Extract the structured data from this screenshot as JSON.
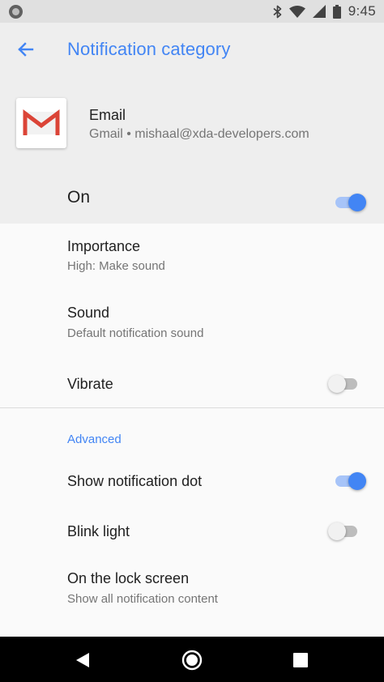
{
  "status_bar": {
    "time": "9:45",
    "icons": [
      "notification-dot-icon",
      "bluetooth-icon",
      "wifi-icon",
      "cellular-signal-icon",
      "battery-icon"
    ]
  },
  "header": {
    "back_icon": "arrow-left-icon",
    "title": "Notification category"
  },
  "app": {
    "icon": "gmail-logo-icon",
    "name": "Email",
    "account": "Gmail • mishaal@xda-developers.com"
  },
  "main_toggle": {
    "label": "On",
    "enabled": true
  },
  "settings": {
    "importance": {
      "title": "Importance",
      "summary": "High: Make sound"
    },
    "sound": {
      "title": "Sound",
      "summary": "Default notification sound"
    },
    "vibrate": {
      "title": "Vibrate",
      "enabled": false
    },
    "advanced_header": "Advanced",
    "notification_dot": {
      "title": "Show notification dot",
      "enabled": true
    },
    "blink_light": {
      "title": "Blink light",
      "enabled": false
    },
    "lock_screen": {
      "title": "On the lock screen",
      "summary": "Show all notification content"
    }
  },
  "nav_bar": {
    "icons": [
      "back-triangle-icon",
      "home-circle-icon",
      "recents-square-icon"
    ]
  },
  "colors": {
    "accent": "#4285f4",
    "header_bg": "#eeeeee",
    "body_bg": "#fafafa",
    "gmail_red": "#db4437"
  }
}
